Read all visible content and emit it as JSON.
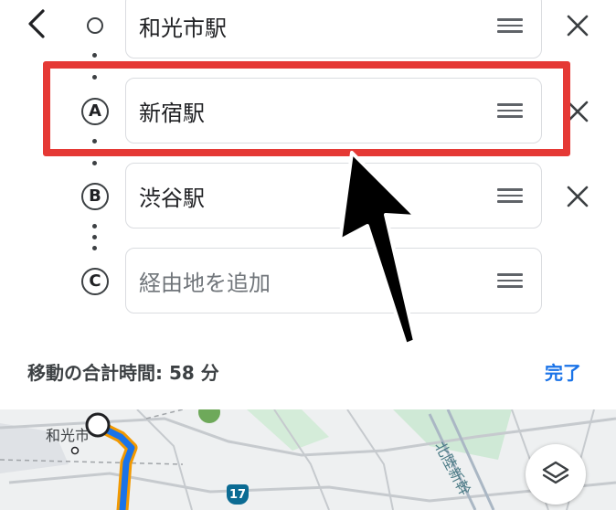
{
  "stops": [
    {
      "marker": "",
      "value": "和光市駅",
      "placeholder": ""
    },
    {
      "marker": "A",
      "value": "新宿駅",
      "placeholder": ""
    },
    {
      "marker": "B",
      "value": "渋谷駅",
      "placeholder": ""
    },
    {
      "marker": "C",
      "value": "",
      "placeholder": "経由地を追加"
    }
  ],
  "summary": {
    "total_time_text": "移動の合計時間: 58 分"
  },
  "actions": {
    "done_label": "完了"
  },
  "map": {
    "place_label": "和光市",
    "rail_label": "北陸新幹",
    "route_number": "17"
  },
  "colors": {
    "accent": "#1a73e8",
    "highlight": "#e53935",
    "route": "#1a73e8",
    "route_outline": "#f29900"
  },
  "icons": {
    "back": "chevron-left-icon",
    "remove": "close-icon",
    "drag": "drag-handle-icon",
    "layers": "layers-icon"
  }
}
